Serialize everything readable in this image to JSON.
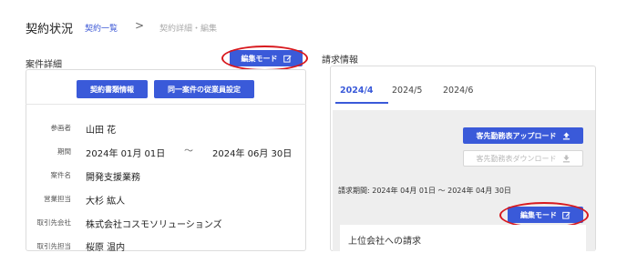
{
  "header": {
    "title": "契約状況",
    "breadcrumb_link": "契約一覧",
    "breadcrumb_sep": ">",
    "breadcrumb_current": "契約詳細・編集"
  },
  "left": {
    "section_title": "案件詳細",
    "edit_mode_button": "編集モード",
    "edit_icon": "edit-icon",
    "doc_info_button": "契約書類情報",
    "same_project_button": "同一案件の従業員設定",
    "rows": [
      {
        "label": "参画者",
        "value": "山田 花"
      },
      {
        "label": "期間",
        "value": "2024年 01月 01日",
        "sep": "〜",
        "value2": "2024年 06月 30日"
      },
      {
        "label": "案件名",
        "value": "開発支援業務"
      },
      {
        "label": "営業担当",
        "value": "大杉 紘人"
      },
      {
        "label": "取引先会社",
        "value": "株式会社コスモソリューションズ"
      },
      {
        "label": "取引先担当",
        "value": "桜原 温内"
      }
    ]
  },
  "right": {
    "section_title": "請求情報",
    "tabs": [
      "2024/4",
      "2024/5",
      "2024/6"
    ],
    "active_tab": 0,
    "upload_button": "客先勤務表アップロード",
    "download_button": "客先勤務表ダウンロード",
    "billing_period": "請求期間: 2024年 04月 01日 〜 2024年 04月 30日",
    "edit_mode_button": "編集モード",
    "parent_invoice_title": "上位会社への請求"
  },
  "colors": {
    "accent": "#3a5ad9",
    "highlight_ring": "#d8191e"
  }
}
